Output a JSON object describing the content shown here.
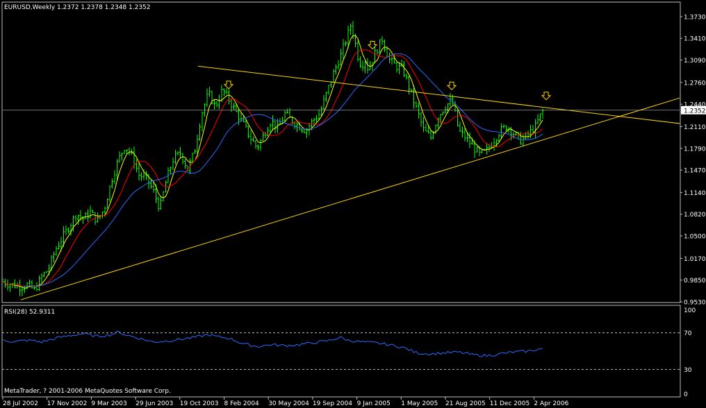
{
  "chart_data": {
    "type": "candlestick",
    "symbol_title": "EURUSD,Weekly  1.2372 1.2378 1.2348 1.2352",
    "current_price_label": "1.2352",
    "colors": {
      "background": "#000000",
      "bars": "#00ff00",
      "axis": "#c0c0c0",
      "ma_fast": "#ffff00",
      "ma_mid": "#ff0000",
      "ma_slow": "#2a6bff",
      "trendline": "#ffd700",
      "rsi": "#2a6bff"
    },
    "y_axis": {
      "range": [
        0.953,
        1.378
      ],
      "tick_labels": [
        "1.3730",
        "1.3410",
        "1.3090",
        "1.2760",
        "1.2440",
        "1.2110",
        "1.1790",
        "1.1470",
        "1.1140",
        "1.0820",
        "1.0500",
        "1.0170",
        "0.9850",
        "0.9530"
      ]
    },
    "x_axis": {
      "tick_labels": [
        "28 Jul 2002",
        "17 Nov 2002",
        "9 Mar 2003",
        "29 Jun 2003",
        "19 Oct 2003",
        "8 Feb 2004",
        "30 May 2004",
        "19 Sep 2004",
        "9 Jan 2005",
        "1 May 2005",
        "21 Aug 2005",
        "11 Dec 2005",
        "2 Apr 2006"
      ]
    },
    "price_path": [
      [
        0,
        0.985
      ],
      [
        10,
        0.98
      ],
      [
        20,
        0.978
      ],
      [
        30,
        0.975
      ],
      [
        40,
        0.978
      ],
      [
        50,
        0.97
      ],
      [
        60,
        0.99
      ],
      [
        70,
        1.002
      ],
      [
        80,
        1.03
      ],
      [
        90,
        1.048
      ],
      [
        100,
        1.065
      ],
      [
        110,
        1.083
      ],
      [
        120,
        1.075
      ],
      [
        130,
        1.085
      ],
      [
        140,
        1.072
      ],
      [
        150,
        1.09
      ],
      [
        160,
        1.13
      ],
      [
        170,
        1.162
      ],
      [
        180,
        1.183
      ],
      [
        190,
        1.168
      ],
      [
        200,
        1.14
      ],
      [
        210,
        1.135
      ],
      [
        220,
        1.118
      ],
      [
        230,
        1.09
      ],
      [
        240,
        1.135
      ],
      [
        250,
        1.165
      ],
      [
        260,
        1.172
      ],
      [
        270,
        1.148
      ],
      [
        280,
        1.175
      ],
      [
        290,
        1.23
      ],
      [
        300,
        1.26
      ],
      [
        310,
        1.24
      ],
      [
        320,
        1.265
      ],
      [
        330,
        1.25
      ],
      [
        340,
        1.232
      ],
      [
        350,
        1.215
      ],
      [
        360,
        1.195
      ],
      [
        370,
        1.18
      ],
      [
        380,
        1.2
      ],
      [
        390,
        1.22
      ],
      [
        400,
        1.208
      ],
      [
        410,
        1.23
      ],
      [
        420,
        1.22
      ],
      [
        430,
        1.212
      ],
      [
        440,
        1.205
      ],
      [
        450,
        1.22
      ],
      [
        460,
        1.23
      ],
      [
        470,
        1.26
      ],
      [
        480,
        1.29
      ],
      [
        490,
        1.315
      ],
      [
        500,
        1.345
      ],
      [
        505,
        1.362
      ],
      [
        510,
        1.34
      ],
      [
        515,
        1.315
      ],
      [
        520,
        1.3
      ],
      [
        525,
        1.31
      ],
      [
        530,
        1.295
      ],
      [
        540,
        1.32
      ],
      [
        550,
        1.34
      ],
      [
        560,
        1.31
      ],
      [
        570,
        1.3
      ],
      [
        580,
        1.295
      ],
      [
        590,
        1.265
      ],
      [
        600,
        1.235
      ],
      [
        610,
        1.205
      ],
      [
        620,
        1.195
      ],
      [
        630,
        1.225
      ],
      [
        640,
        1.24
      ],
      [
        650,
        1.25
      ],
      [
        655,
        1.23
      ],
      [
        660,
        1.205
      ],
      [
        670,
        1.195
      ],
      [
        680,
        1.182
      ],
      [
        690,
        1.17
      ],
      [
        700,
        1.175
      ],
      [
        710,
        1.19
      ],
      [
        720,
        1.205
      ],
      [
        730,
        1.212
      ],
      [
        740,
        1.2
      ],
      [
        750,
        1.19
      ],
      [
        760,
        1.2
      ],
      [
        770,
        1.21
      ],
      [
        778,
        1.228
      ],
      [
        782,
        1.2352
      ]
    ],
    "trendlines": [
      {
        "name": "resistance",
        "from": [
          285,
          1.3
        ],
        "to": [
          1016,
          1.211
        ]
      },
      {
        "name": "support",
        "from": [
          30,
          0.956
        ],
        "to": [
          1016,
          1.265
        ]
      }
    ],
    "markers_down_arrows_at_x": [
      329,
      536,
      650,
      786
    ],
    "rsi": {
      "label": "RSI(28) 52.9311",
      "range": [
        0,
        100
      ],
      "tick_labels": [
        "100",
        "70",
        "30",
        "0"
      ],
      "levels": [
        70,
        30
      ],
      "path": [
        [
          0,
          63
        ],
        [
          20,
          60
        ],
        [
          40,
          62
        ],
        [
          60,
          60
        ],
        [
          80,
          64
        ],
        [
          100,
          67
        ],
        [
          120,
          69
        ],
        [
          140,
          66
        ],
        [
          160,
          68
        ],
        [
          170,
          71
        ],
        [
          180,
          68
        ],
        [
          200,
          64
        ],
        [
          220,
          60
        ],
        [
          240,
          61
        ],
        [
          260,
          63
        ],
        [
          280,
          65
        ],
        [
          300,
          68
        ],
        [
          310,
          66
        ],
        [
          330,
          64
        ],
        [
          350,
          58
        ],
        [
          370,
          55
        ],
        [
          390,
          57
        ],
        [
          410,
          56
        ],
        [
          430,
          57
        ],
        [
          450,
          59
        ],
        [
          470,
          61
        ],
        [
          490,
          65
        ],
        [
          500,
          62
        ],
        [
          520,
          60
        ],
        [
          540,
          59
        ],
        [
          560,
          57
        ],
        [
          580,
          54
        ],
        [
          600,
          48
        ],
        [
          620,
          47
        ],
        [
          640,
          48
        ],
        [
          660,
          49
        ],
        [
          680,
          46
        ],
        [
          700,
          45
        ],
        [
          720,
          47
        ],
        [
          740,
          49
        ],
        [
          760,
          50
        ],
        [
          782,
          53
        ]
      ]
    }
  },
  "footer_text": "MetaTrader, ? 2001-2006 MetaQuotes Software Corp."
}
